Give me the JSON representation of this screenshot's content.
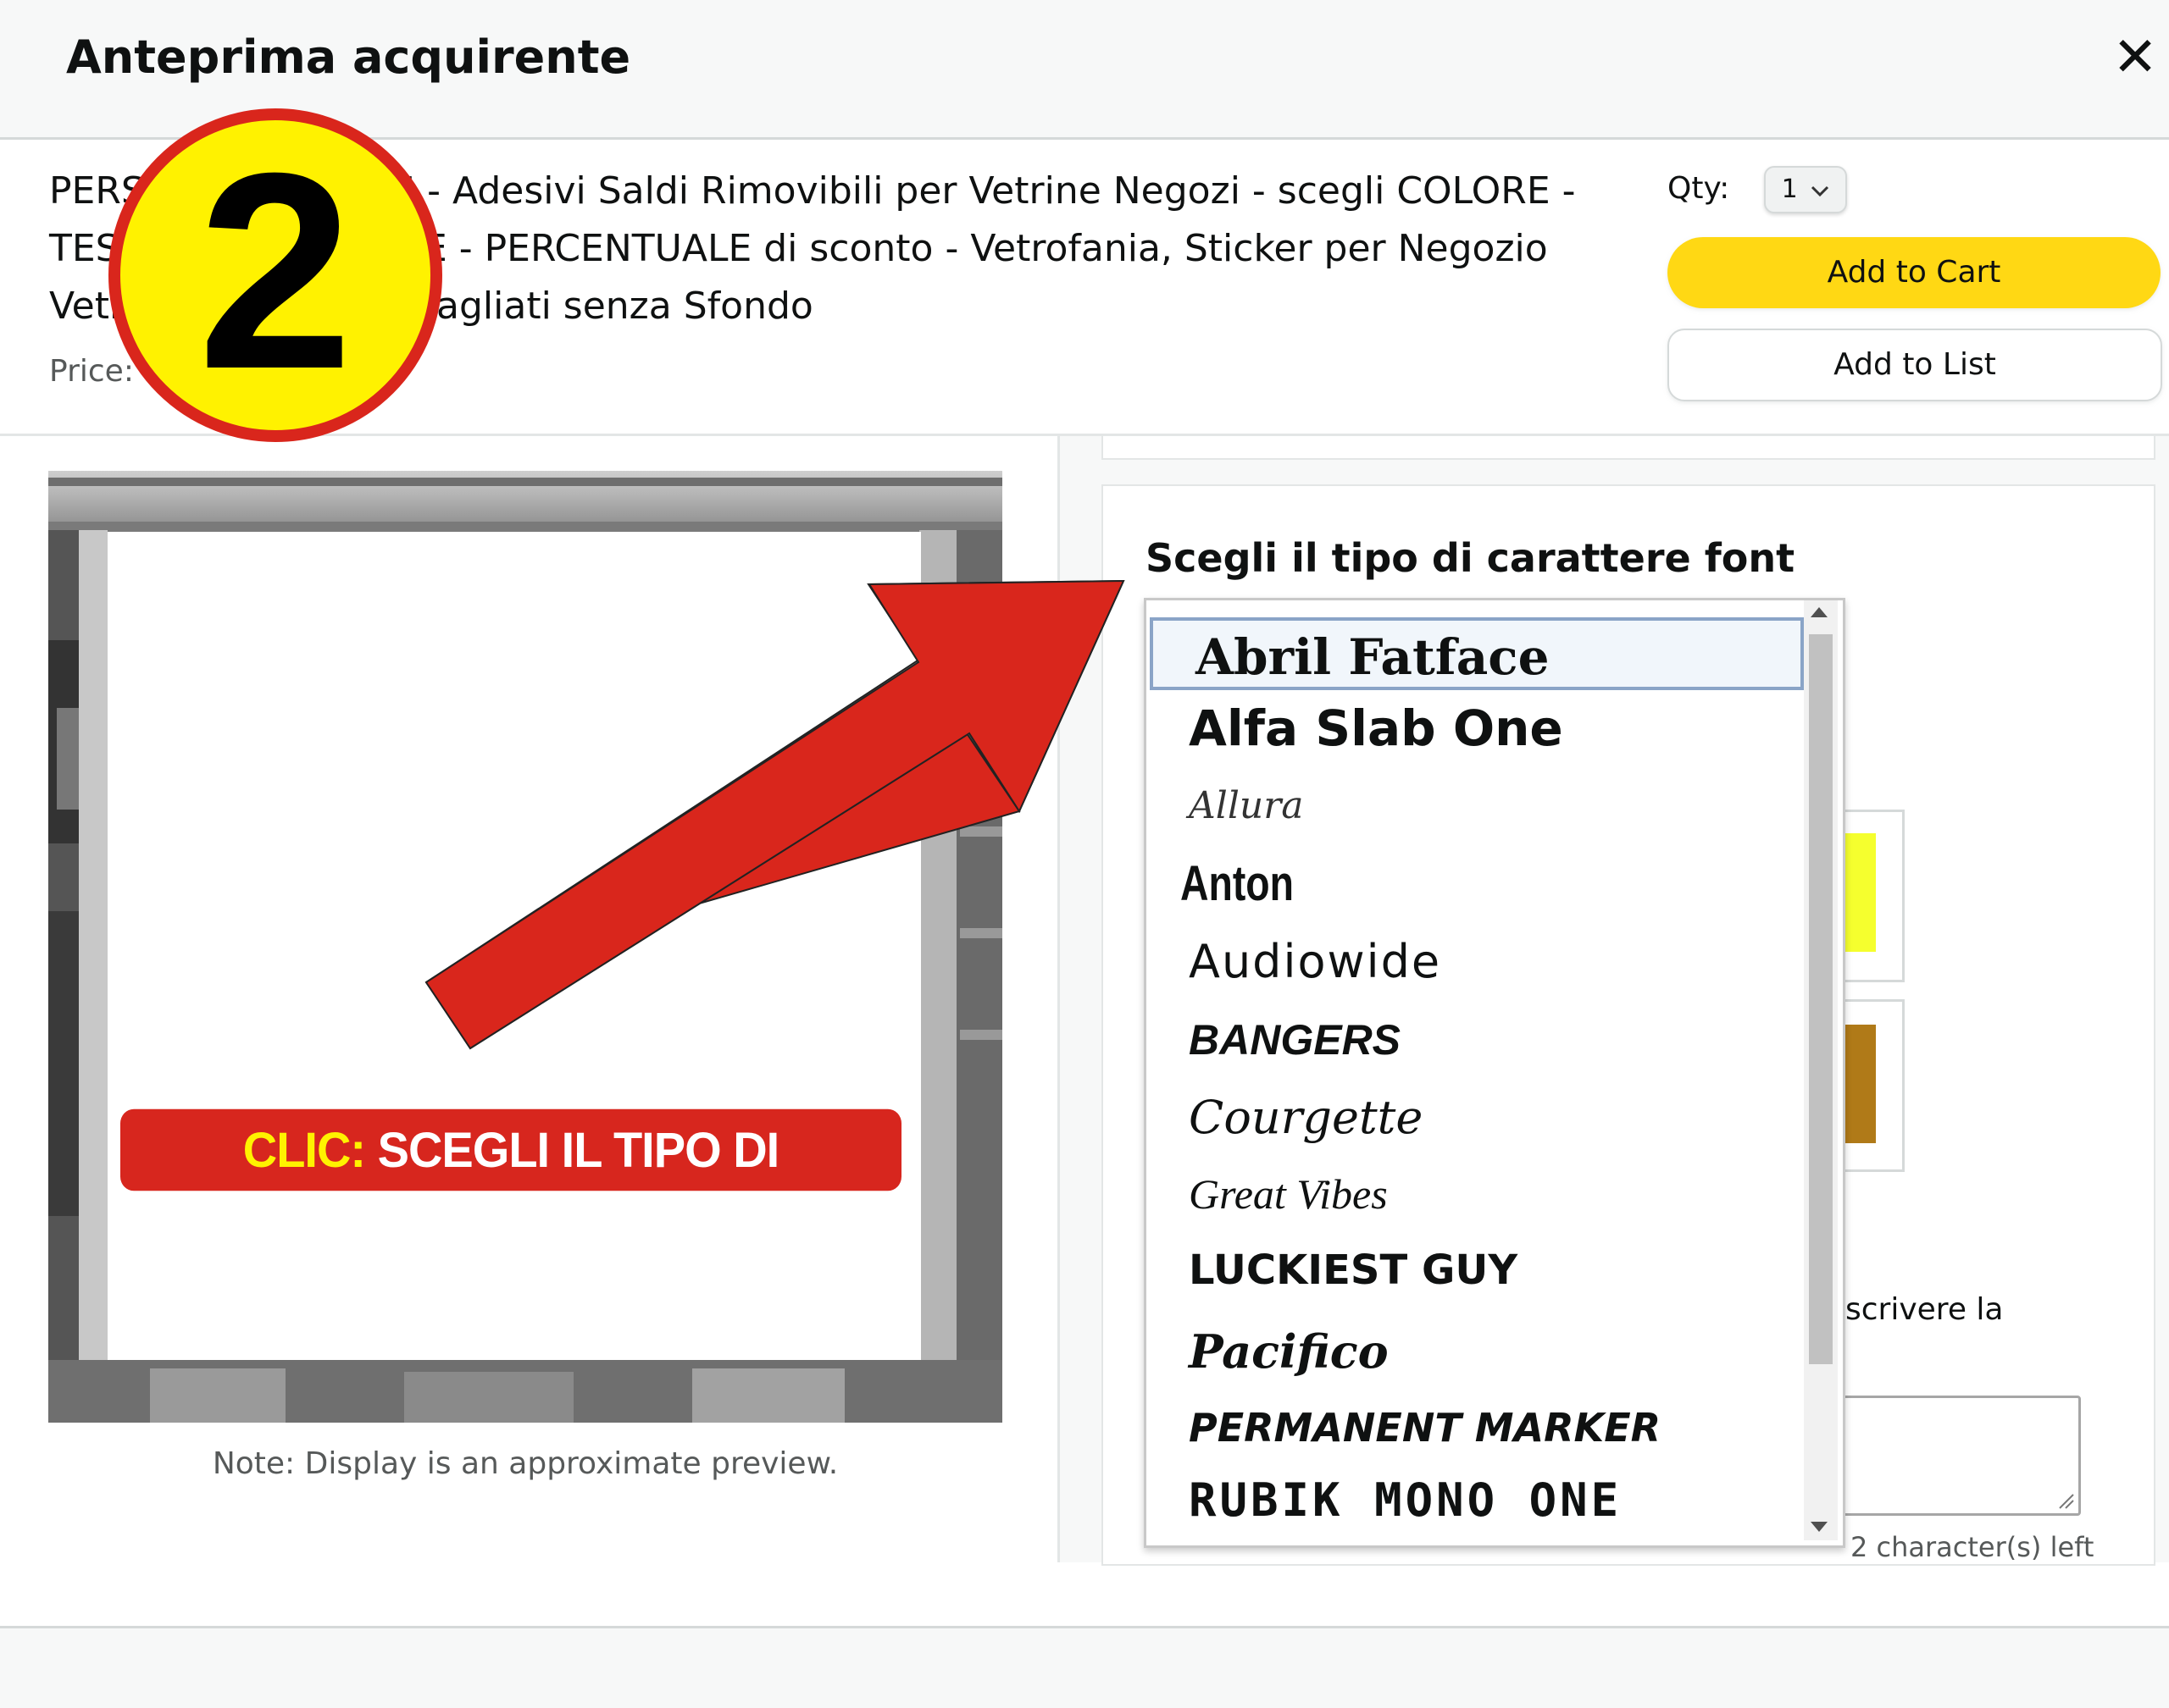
{
  "header": {
    "title": "Anteprima acquirente",
    "close": "✕"
  },
  "product": {
    "title": "PERSONALIZZA QUI - Adesivi Saldi Rimovibili per Vetrine Negozi - scegli COLORE - TESTO - DIMENSIONE - PERCENTUALE di sconto - Vetrofania, Sticker per Negozio Vetrine Decorate. intagliati senza Sfondo",
    "price_label": "Price:"
  },
  "purchase": {
    "qty_label": "Qty:",
    "qty_value": "1",
    "add_to_cart": "Add to Cart",
    "add_to_list": "Add to List"
  },
  "preview": {
    "note": "Note: Display is an approximate preview."
  },
  "customizer": {
    "font_label": "Scegli il tipo di carattere font",
    "fonts": [
      "Abril Fatface",
      "Alfa Slab One",
      "Allura",
      "Anton",
      "Audiowide",
      "BANGERS",
      "Courgette",
      "Great Vibes",
      "LUCKIEST GUY",
      "Pacifico",
      "PERMANENT MARKER",
      "RUBIK MONO ONE"
    ],
    "selected_font": "Abril Fatface",
    "side_text": "scrivere la",
    "chars_left": "2 character(s) left",
    "swatch_colors": [
      "#f5ff2e",
      "#b07a18"
    ]
  },
  "annotation": {
    "step_number": "2",
    "banner_prefix": "CLIC:",
    "banner_text": " SCEGLI IL TIPO DI SCRITTURA"
  },
  "colors": {
    "accent_yellow": "#ffd814",
    "annotation_red": "#d7261e",
    "badge_yellow": "#fff200"
  }
}
